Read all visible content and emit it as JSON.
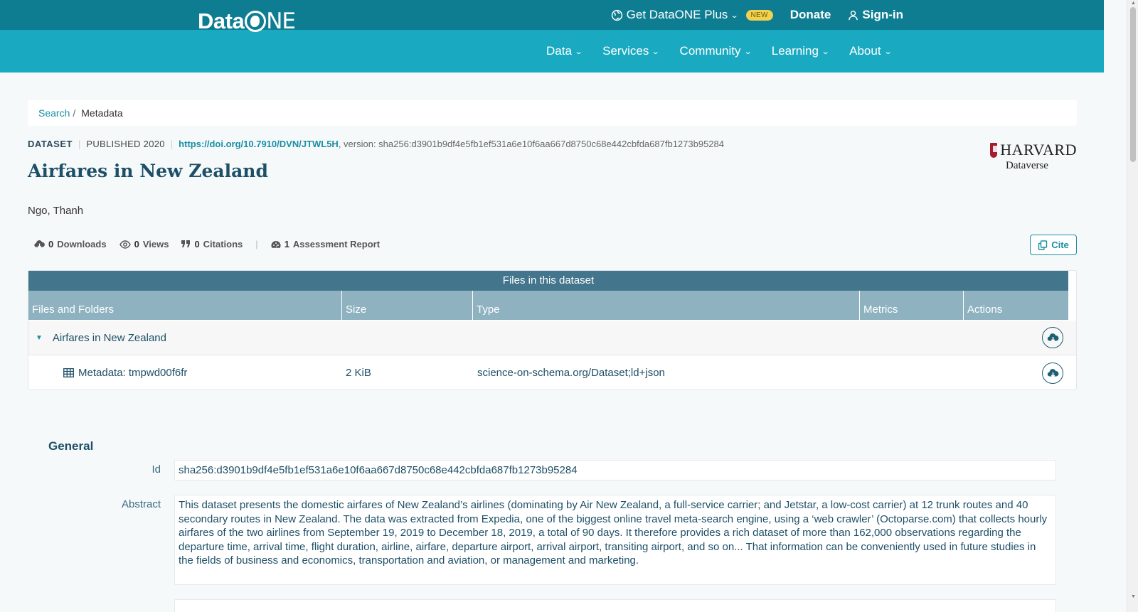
{
  "topbar": {
    "plus_label": "Get DataONE Plus",
    "new_badge": "NEW",
    "donate_label": "Donate",
    "signin_label": "Sign-in"
  },
  "brand": {
    "logo_text_left": "Data",
    "logo_text_right": "NE"
  },
  "nav": {
    "items": [
      {
        "label": "Data"
      },
      {
        "label": "Services"
      },
      {
        "label": "Community"
      },
      {
        "label": "Learning"
      },
      {
        "label": "About"
      }
    ]
  },
  "breadcrumb": {
    "search": "Search",
    "sep": "/",
    "current": "Metadata"
  },
  "dataset": {
    "type": "DATASET",
    "published": "PUBLISHED 2020",
    "doi": "https://doi.org/10.7910/DVN/JTWL5H",
    "version": ", version: sha256:d3901b9df4e5fb1ef531a6e10f6aa667d8750c68e442cbfda687fb1273b95284",
    "title": "Airfares in New Zealand",
    "author": "Ngo, Thanh"
  },
  "repository": {
    "name": "HARVARD",
    "sub": "Dataverse"
  },
  "stats": {
    "downloads_count": "0",
    "downloads_label": "Downloads",
    "views_count": "0",
    "views_label": "Views",
    "citations_count": "0",
    "citations_label": "Citations",
    "assessment_count": "1",
    "assessment_label": "Assessment Report"
  },
  "cite_label": "Cite",
  "files": {
    "title": "Files in this dataset",
    "columns": [
      "Files and Folders",
      "Size",
      "Type",
      "Metrics",
      "Actions"
    ],
    "folder": {
      "name": "Airfares in New Zealand"
    },
    "file": {
      "name": "Metadata: tmpwd00f6fr",
      "size": "2 KiB",
      "type": "science-on-schema.org/Dataset;ld+json"
    }
  },
  "general": {
    "heading": "General",
    "id_label": "Id",
    "id_value": "sha256:d3901b9df4e5fb1ef531a6e10f6aa667d8750c68e442cbfda687fb1273b95284",
    "abstract_label": "Abstract",
    "abstract_value": "This dataset presents the domestic airfares of New Zealand’s airlines (dominating by Air New Zealand, a full-service carrier; and Jetstar, a low-cost carrier) at 12 trunk routes and 40 secondary routes in New Zealand. The data was extracted from Expedia, one of the biggest online travel meta-search engine, using a ‘web crawler’ (Octoparse.com) that collects hourly airfares of the two airlines from September 19, 2019 to December 18, 2019, a total of 90 days. It therefore provides a rich dataset of more than 162,000 observations regarding the departure time, arrival time, flight duration, airline, airfare, departure airport, arrival airport, transiting airport, and so on... That information can be conveniently used in future studies in the fields of business and economics, transportation and aviation, or management and marketing."
  },
  "colors": {
    "topbar": "#0e7d92",
    "navbar": "#19a9c0",
    "accent": "#1a8fa6",
    "table_header": "#43768c"
  }
}
